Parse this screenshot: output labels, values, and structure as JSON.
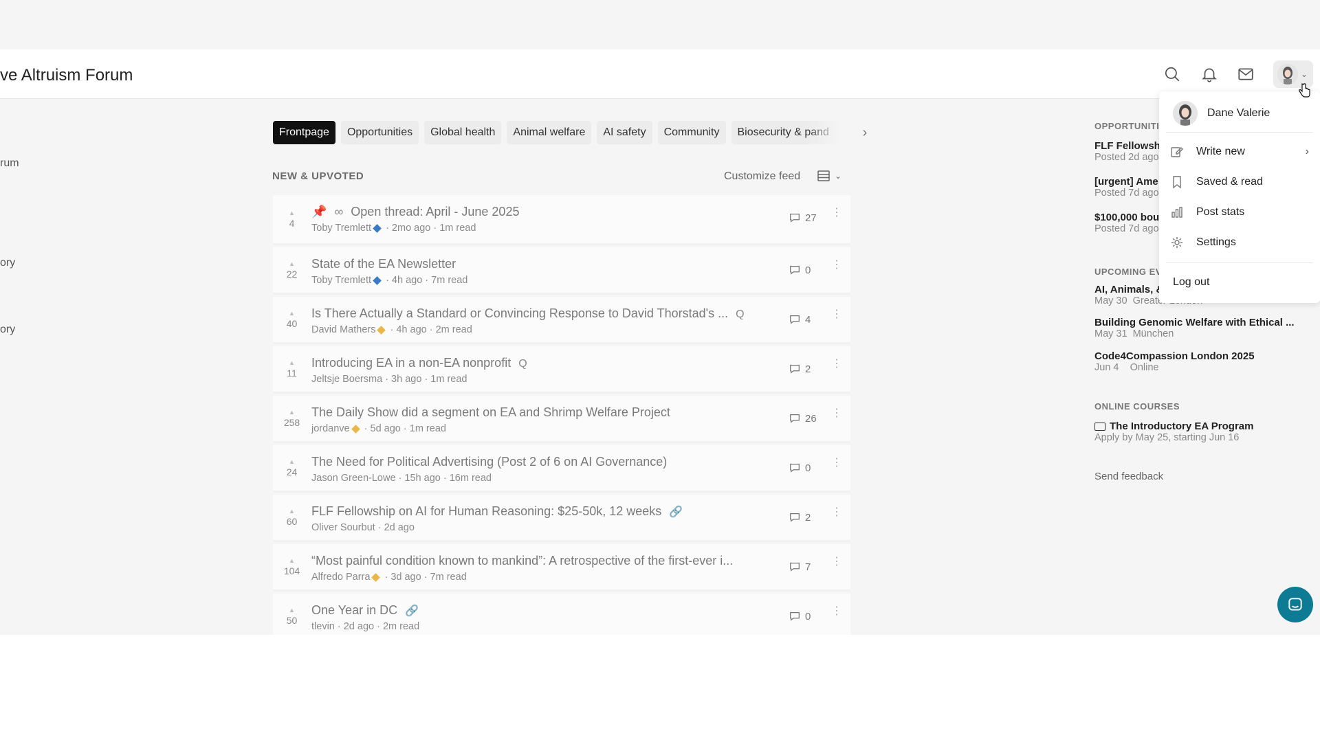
{
  "header": {
    "site_title": "ve Altruism Forum"
  },
  "left_sidebar": {
    "fragments": [
      "rum",
      "ory",
      "ory"
    ]
  },
  "tabs": [
    {
      "label": "Frontpage",
      "active": true
    },
    {
      "label": "Opportunities",
      "active": false
    },
    {
      "label": "Global health",
      "active": false
    },
    {
      "label": "Animal welfare",
      "active": false
    },
    {
      "label": "AI safety",
      "active": false
    },
    {
      "label": "Community",
      "active": false
    },
    {
      "label": "Biosecurity & pand",
      "active": false
    }
  ],
  "feed": {
    "section_title": "NEW & UPVOTED",
    "customize_label": "Customize feed"
  },
  "posts": [
    {
      "votes": "4",
      "title": "Open thread: April - June 2025",
      "tag": "",
      "author": "Toby Tremlett",
      "diamond": "#3a79c4",
      "meta": "· 2mo ago · 1m read",
      "comments": "27"
    },
    {
      "votes": "22",
      "title": "State of the EA Newsletter",
      "tag": "",
      "author": "Toby Tremlett",
      "diamond": "#3a79c4",
      "meta": "· 4h ago · 7m read",
      "comments": "0"
    },
    {
      "votes": "40",
      "title": "Is There Actually a Standard or Convincing Response to David Thorstad's ...",
      "tag": "Q",
      "author": "David Mathers",
      "diamond": "#e9b84a",
      "meta": "· 4h ago · 2m read",
      "comments": "4"
    },
    {
      "votes": "11",
      "title": "Introducing EA in a non-EA nonprofit",
      "tag": "Q",
      "author": "Jeltsje Boersma",
      "diamond": "",
      "meta": "· 3h ago · 1m read",
      "comments": "2"
    },
    {
      "votes": "258",
      "title": "The Daily Show did a segment on EA and Shrimp Welfare Project",
      "tag": "",
      "author": "jordanve",
      "diamond": "#e9b84a",
      "meta": "· 5d ago · 1m read",
      "comments": "26"
    },
    {
      "votes": "24",
      "title": "The Need for Political Advertising (Post 2 of 6 on AI Governance)",
      "tag": "",
      "author": "Jason Green-Lowe",
      "diamond": "",
      "meta": "· 15h ago · 16m read",
      "comments": "0"
    },
    {
      "votes": "60",
      "title": "FLF Fellowship on AI for Human Reasoning: $25-50k, 12 weeks",
      "tag": "🔗",
      "author": "Oliver Sourbut",
      "diamond": "",
      "meta": "· 2d ago",
      "comments": "2"
    },
    {
      "votes": "104",
      "title": "“Most painful condition known to mankind”: A retrospective of the first-ever i...",
      "tag": "",
      "author": "Alfredo Parra",
      "diamond": "#e9b84a",
      "meta": "· 3d ago · 7m read",
      "comments": "7"
    },
    {
      "votes": "50",
      "title": "One Year in DC",
      "tag": "🔗",
      "author": "tlevin",
      "diamond": "",
      "meta": "· 2d ago · 2m read",
      "comments": "0"
    }
  ],
  "right_column": {
    "opportunities_heading": "OPPORTUNITI",
    "opportunities": [
      {
        "title": "FLF Fellowshi",
        "sub": "Posted 2d ago"
      },
      {
        "title": "[urgent] Ame",
        "sub": "Posted 7d ago"
      },
      {
        "title": "$100,000 bou",
        "sub": "Posted 7d ago"
      }
    ],
    "events_heading": "UPCOMING EV",
    "events": [
      {
        "title": "AI, Animals, &",
        "sub": "May 30  Greater London"
      },
      {
        "title": "Building Genomic Welfare with Ethical ...",
        "sub": "May 31  München"
      },
      {
        "title": "Code4Compassion London 2025",
        "sub": "Jun 4    Online"
      }
    ],
    "courses_heading": "ONLINE COURSES",
    "course": {
      "title": "The Introductory EA Program",
      "sub": "Apply by May 25, starting Jun 16"
    },
    "feedback": "Send feedback"
  },
  "dropdown": {
    "user_name": "Dane Valerie",
    "items": [
      {
        "label": "Write new",
        "icon": "pencil-icon"
      },
      {
        "label": "Saved & read",
        "icon": "bookmark-icon"
      },
      {
        "label": "Post stats",
        "icon": "bar-chart-icon"
      },
      {
        "label": "Settings",
        "icon": "gear-icon"
      }
    ],
    "logout": "Log out"
  }
}
